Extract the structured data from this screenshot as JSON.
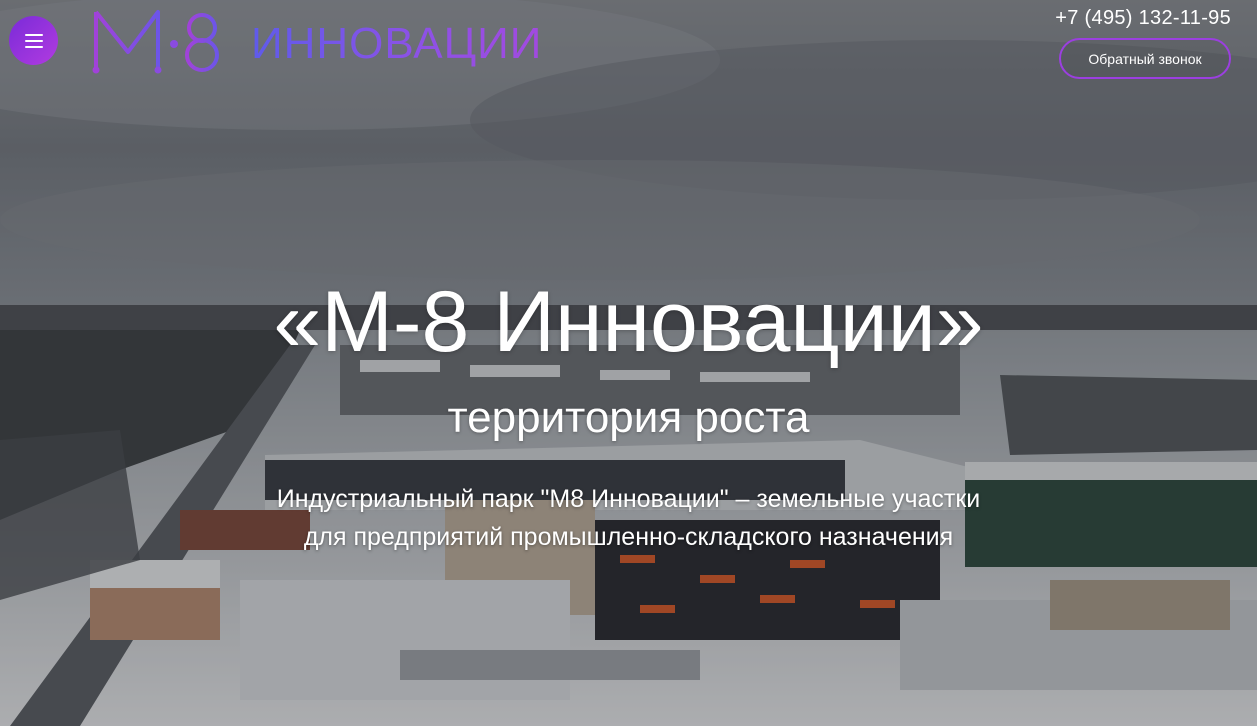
{
  "header": {
    "logo_mark": "M·8",
    "logo_word": "ИННОВАЦИИ",
    "phone": "+7 (495) 132-11-95",
    "callback_label": "Обратный звонок"
  },
  "hero": {
    "title": "«М-8 Инновации»",
    "subtitle": "территория роста",
    "description_lines": [
      "Индустриальный парк \"М8 Инновации\" – земельные участки",
      "для предприятий промышленно-складского назначения"
    ]
  },
  "icons": {
    "menu": "hamburger-menu-icon"
  },
  "colors": {
    "accent_purple": "#9b3fe0",
    "menu_gradient_start": "#7a2bd8",
    "menu_gradient_end": "#b13be0",
    "logo_blue": "#5f5bea"
  }
}
